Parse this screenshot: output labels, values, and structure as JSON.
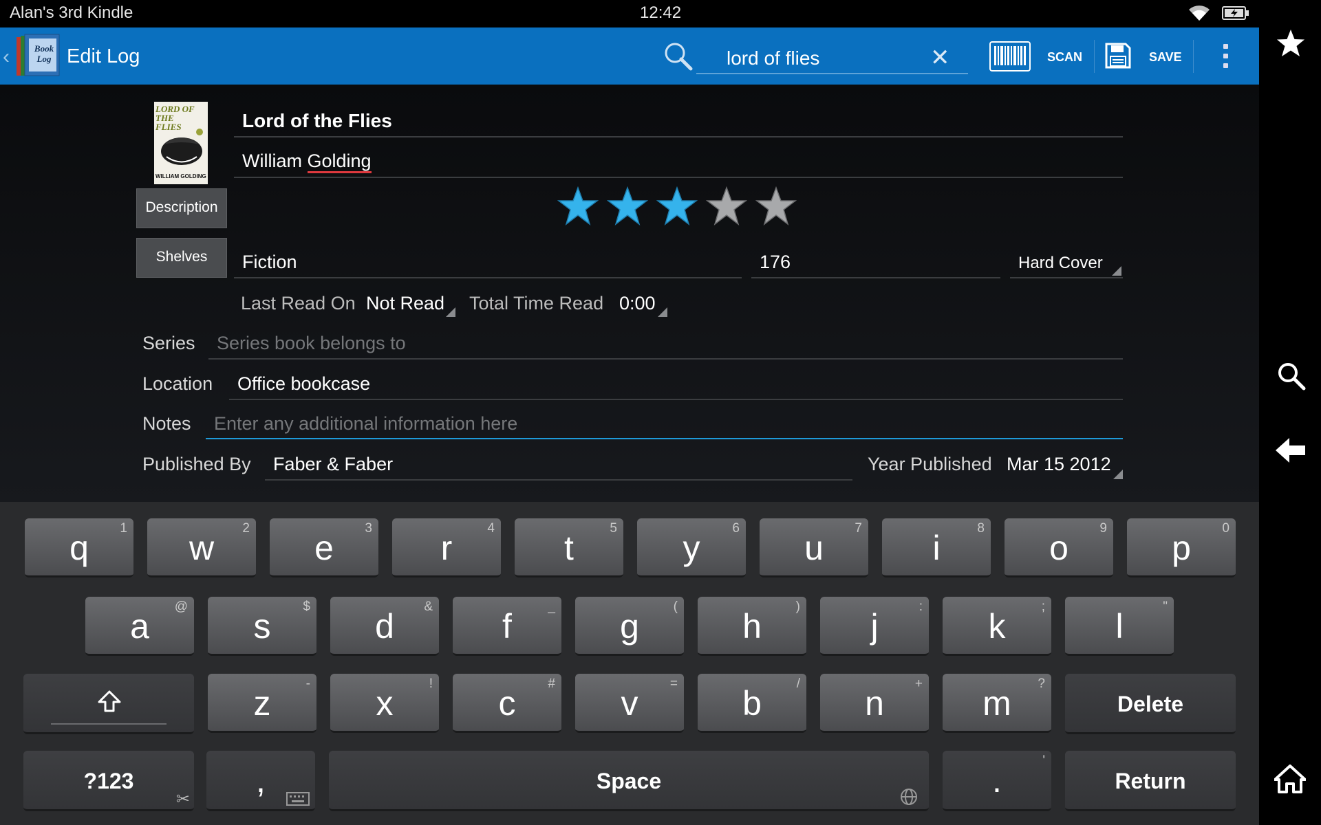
{
  "status_bar": {
    "device_name": "Alan's 3rd Kindle",
    "time": "12:42"
  },
  "action_bar": {
    "app_icon_text": "Book Log",
    "title": "Edit Log",
    "search_query": "lord of flies",
    "scan_label": "SCAN",
    "save_label": "SAVE"
  },
  "book": {
    "title": "Lord of the Flies",
    "author_first": "William ",
    "author_last": "Golding",
    "rating": 3,
    "rating_max": 5,
    "genre": "Fiction",
    "pages": "176",
    "format": "Hard Cover",
    "last_read_label": "Last Read On",
    "last_read_value": "Not Read",
    "total_time_label": "Total Time Read",
    "total_time_value": "0:00",
    "series_label": "Series",
    "series_placeholder": "Series book belongs to",
    "location_label": "Location",
    "location_value": "Office bookcase",
    "notes_label": "Notes",
    "notes_placeholder": "Enter any additional information here",
    "publisher_label": "Published By",
    "publisher_value": "Faber & Faber",
    "year_label": "Year Published",
    "year_value": "Mar 15 2012",
    "cover_title": "LORD OF THE FLIES",
    "cover_author": "WILLIAM GOLDING"
  },
  "buttons": {
    "description": "Description",
    "shelves": "Shelves"
  },
  "colors": {
    "action_bar": "#0a70bf",
    "star_on": "#35b3ec",
    "star_off": "#a8a9ab",
    "focus_line": "#1e9ad8"
  },
  "keyboard": {
    "row1": [
      {
        "k": "q",
        "s": "1"
      },
      {
        "k": "w",
        "s": "2"
      },
      {
        "k": "e",
        "s": "3"
      },
      {
        "k": "r",
        "s": "4"
      },
      {
        "k": "t",
        "s": "5"
      },
      {
        "k": "y",
        "s": "6"
      },
      {
        "k": "u",
        "s": "7"
      },
      {
        "k": "i",
        "s": "8"
      },
      {
        "k": "o",
        "s": "9"
      },
      {
        "k": "p",
        "s": "0"
      }
    ],
    "row2": [
      {
        "k": "a",
        "s": "@"
      },
      {
        "k": "s",
        "s": "$"
      },
      {
        "k": "d",
        "s": "&"
      },
      {
        "k": "f",
        "s": "_"
      },
      {
        "k": "g",
        "s": "("
      },
      {
        "k": "h",
        "s": ")"
      },
      {
        "k": "j",
        "s": ":"
      },
      {
        "k": "k",
        "s": ";"
      },
      {
        "k": "l",
        "s": "\""
      }
    ],
    "row3": [
      {
        "k": "z",
        "s": "-"
      },
      {
        "k": "x",
        "s": "!"
      },
      {
        "k": "c",
        "s": "#"
      },
      {
        "k": "v",
        "s": "="
      },
      {
        "k": "b",
        "s": "/"
      },
      {
        "k": "n",
        "s": "+"
      },
      {
        "k": "m",
        "s": "?"
      }
    ],
    "shift_icon": "shift-icon",
    "delete_label": "Delete",
    "symbols_label": "?123",
    "comma": ",",
    "space_label": "Space",
    "period": ".",
    "period_sub": "'",
    "return_label": "Return"
  }
}
